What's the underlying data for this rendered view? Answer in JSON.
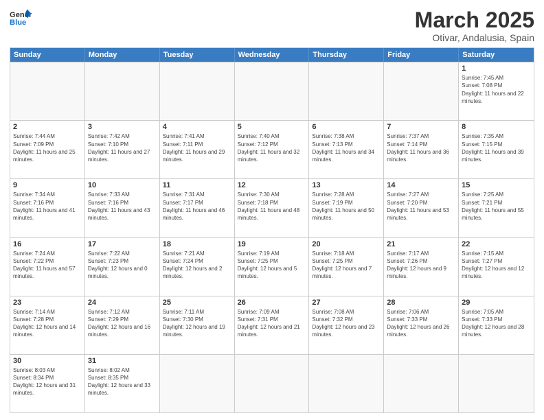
{
  "header": {
    "logo_general": "General",
    "logo_blue": "Blue",
    "month_title": "March 2025",
    "subtitle": "Otivar, Andalusia, Spain"
  },
  "days_of_week": [
    "Sunday",
    "Monday",
    "Tuesday",
    "Wednesday",
    "Thursday",
    "Friday",
    "Saturday"
  ],
  "rows": [
    [
      {
        "day": "",
        "info": ""
      },
      {
        "day": "",
        "info": ""
      },
      {
        "day": "",
        "info": ""
      },
      {
        "day": "",
        "info": ""
      },
      {
        "day": "",
        "info": ""
      },
      {
        "day": "",
        "info": ""
      },
      {
        "day": "1",
        "info": "Sunrise: 7:45 AM\nSunset: 7:08 PM\nDaylight: 11 hours and 22 minutes."
      }
    ],
    [
      {
        "day": "2",
        "info": "Sunrise: 7:44 AM\nSunset: 7:09 PM\nDaylight: 11 hours and 25 minutes."
      },
      {
        "day": "3",
        "info": "Sunrise: 7:42 AM\nSunset: 7:10 PM\nDaylight: 11 hours and 27 minutes."
      },
      {
        "day": "4",
        "info": "Sunrise: 7:41 AM\nSunset: 7:11 PM\nDaylight: 11 hours and 29 minutes."
      },
      {
        "day": "5",
        "info": "Sunrise: 7:40 AM\nSunset: 7:12 PM\nDaylight: 11 hours and 32 minutes."
      },
      {
        "day": "6",
        "info": "Sunrise: 7:38 AM\nSunset: 7:13 PM\nDaylight: 11 hours and 34 minutes."
      },
      {
        "day": "7",
        "info": "Sunrise: 7:37 AM\nSunset: 7:14 PM\nDaylight: 11 hours and 36 minutes."
      },
      {
        "day": "8",
        "info": "Sunrise: 7:35 AM\nSunset: 7:15 PM\nDaylight: 11 hours and 39 minutes."
      }
    ],
    [
      {
        "day": "9",
        "info": "Sunrise: 7:34 AM\nSunset: 7:16 PM\nDaylight: 11 hours and 41 minutes."
      },
      {
        "day": "10",
        "info": "Sunrise: 7:33 AM\nSunset: 7:16 PM\nDaylight: 11 hours and 43 minutes."
      },
      {
        "day": "11",
        "info": "Sunrise: 7:31 AM\nSunset: 7:17 PM\nDaylight: 11 hours and 46 minutes."
      },
      {
        "day": "12",
        "info": "Sunrise: 7:30 AM\nSunset: 7:18 PM\nDaylight: 11 hours and 48 minutes."
      },
      {
        "day": "13",
        "info": "Sunrise: 7:28 AM\nSunset: 7:19 PM\nDaylight: 11 hours and 50 minutes."
      },
      {
        "day": "14",
        "info": "Sunrise: 7:27 AM\nSunset: 7:20 PM\nDaylight: 11 hours and 53 minutes."
      },
      {
        "day": "15",
        "info": "Sunrise: 7:25 AM\nSunset: 7:21 PM\nDaylight: 11 hours and 55 minutes."
      }
    ],
    [
      {
        "day": "16",
        "info": "Sunrise: 7:24 AM\nSunset: 7:22 PM\nDaylight: 11 hours and 57 minutes."
      },
      {
        "day": "17",
        "info": "Sunrise: 7:22 AM\nSunset: 7:23 PM\nDaylight: 12 hours and 0 minutes."
      },
      {
        "day": "18",
        "info": "Sunrise: 7:21 AM\nSunset: 7:24 PM\nDaylight: 12 hours and 2 minutes."
      },
      {
        "day": "19",
        "info": "Sunrise: 7:19 AM\nSunset: 7:25 PM\nDaylight: 12 hours and 5 minutes."
      },
      {
        "day": "20",
        "info": "Sunrise: 7:18 AM\nSunset: 7:25 PM\nDaylight: 12 hours and 7 minutes."
      },
      {
        "day": "21",
        "info": "Sunrise: 7:17 AM\nSunset: 7:26 PM\nDaylight: 12 hours and 9 minutes."
      },
      {
        "day": "22",
        "info": "Sunrise: 7:15 AM\nSunset: 7:27 PM\nDaylight: 12 hours and 12 minutes."
      }
    ],
    [
      {
        "day": "23",
        "info": "Sunrise: 7:14 AM\nSunset: 7:28 PM\nDaylight: 12 hours and 14 minutes."
      },
      {
        "day": "24",
        "info": "Sunrise: 7:12 AM\nSunset: 7:29 PM\nDaylight: 12 hours and 16 minutes."
      },
      {
        "day": "25",
        "info": "Sunrise: 7:11 AM\nSunset: 7:30 PM\nDaylight: 12 hours and 19 minutes."
      },
      {
        "day": "26",
        "info": "Sunrise: 7:09 AM\nSunset: 7:31 PM\nDaylight: 12 hours and 21 minutes."
      },
      {
        "day": "27",
        "info": "Sunrise: 7:08 AM\nSunset: 7:32 PM\nDaylight: 12 hours and 23 minutes."
      },
      {
        "day": "28",
        "info": "Sunrise: 7:06 AM\nSunset: 7:33 PM\nDaylight: 12 hours and 26 minutes."
      },
      {
        "day": "29",
        "info": "Sunrise: 7:05 AM\nSunset: 7:33 PM\nDaylight: 12 hours and 28 minutes."
      }
    ],
    [
      {
        "day": "30",
        "info": "Sunrise: 8:03 AM\nSunset: 8:34 PM\nDaylight: 12 hours and 31 minutes."
      },
      {
        "day": "31",
        "info": "Sunrise: 8:02 AM\nSunset: 8:35 PM\nDaylight: 12 hours and 33 minutes."
      },
      {
        "day": "",
        "info": ""
      },
      {
        "day": "",
        "info": ""
      },
      {
        "day": "",
        "info": ""
      },
      {
        "day": "",
        "info": ""
      },
      {
        "day": "",
        "info": ""
      }
    ]
  ]
}
